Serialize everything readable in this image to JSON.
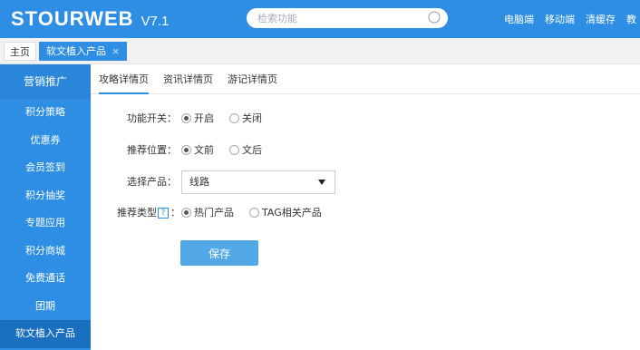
{
  "header": {
    "brand": "STOURWEB",
    "version": "V7.1",
    "search_placeholder": "检索功能",
    "nav": [
      "电脑端",
      "移动端",
      "清缓存",
      "教"
    ]
  },
  "tabs": {
    "home": "主页",
    "active": "软文植入产品",
    "close": "×"
  },
  "sidebar": {
    "header": "营销推广",
    "items": [
      {
        "label": "积分策略"
      },
      {
        "label": "优惠券"
      },
      {
        "label": "会员签到"
      },
      {
        "label": "积分抽奖"
      },
      {
        "label": "专题应用"
      },
      {
        "label": "积分商城"
      },
      {
        "label": "免费通话"
      },
      {
        "label": "团期"
      },
      {
        "label": "软文植入产品",
        "active": true
      }
    ]
  },
  "subtabs": [
    "攻略详情页",
    "资讯详情页",
    "游记详情页"
  ],
  "form": {
    "switch": {
      "label": "功能开关：",
      "options": [
        "开启",
        "关闭"
      ],
      "selected": 0
    },
    "position": {
      "label": "推荐位置：",
      "options": [
        "文前",
        "文后"
      ],
      "selected": 0
    },
    "product": {
      "label": "选择产品：",
      "value": "线路"
    },
    "type": {
      "label": "推荐类型",
      "help": "?",
      "options": [
        "热门产品",
        "TAG相关产品"
      ],
      "selected": 0,
      "suffix": "："
    },
    "save_label": "保存"
  },
  "colors": {
    "primary": "#2d8ee3",
    "sidebar_active": "#1b6fbf",
    "save_button": "#52a8e6"
  }
}
